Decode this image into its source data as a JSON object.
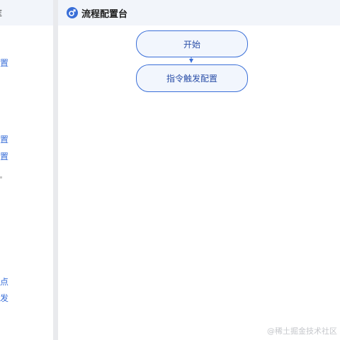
{
  "sidebar": {
    "title": "库",
    "groups": [
      {
        "label": "置"
      },
      {
        "label": "置"
      },
      {
        "label": "置"
      }
    ],
    "items": [
      {
        "label": "配置"
      },
      {
        "label": "配置"
      },
      {
        "label": "配置"
      },
      {
        "label": "节点"
      },
      {
        "label": "转发"
      }
    ]
  },
  "header": {
    "title": "流程配置台",
    "logo_icon": "flow-logo-icon"
  },
  "flow": {
    "nodes": [
      {
        "label": "开始"
      },
      {
        "label": "指令触发配置"
      }
    ]
  },
  "watermark": "@稀土掘金技术社区",
  "colors": {
    "accent": "#3a6fd8",
    "node_fill": "#f2f6fd",
    "header_bg": "#f2f5fa",
    "divider": "#e9eaed"
  }
}
